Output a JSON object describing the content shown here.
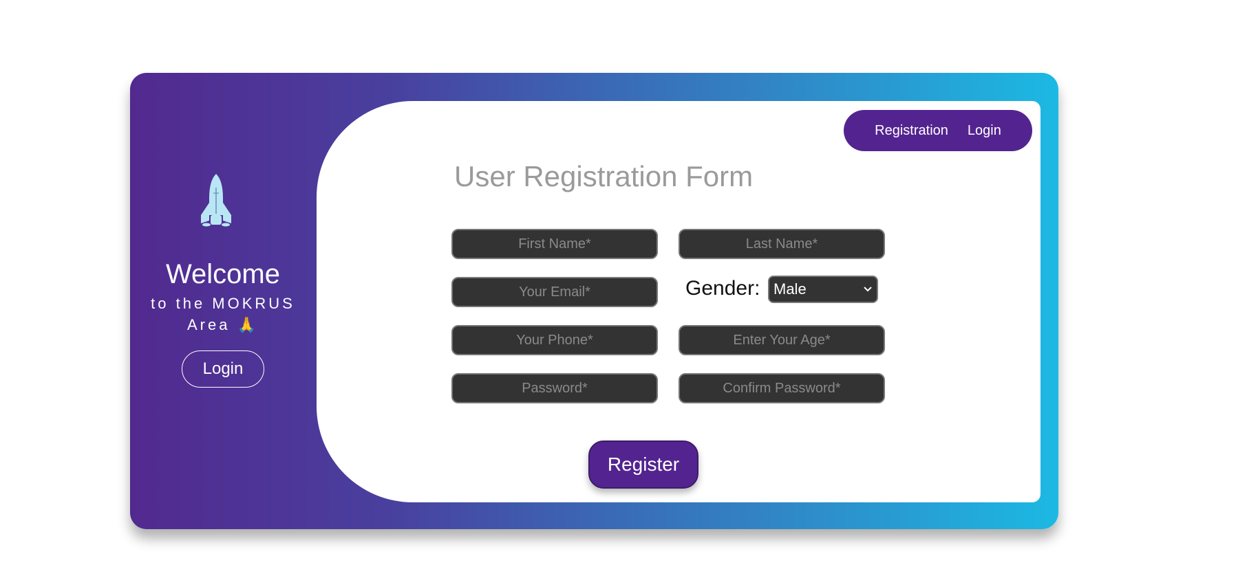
{
  "sidebar": {
    "rocket_icon": "rocket-icon",
    "welcome": "Welcome",
    "subtitle_line1": "to the MOKRUS",
    "subtitle_line2": "Area 🙏",
    "login_button": "Login"
  },
  "nav": {
    "registration": "Registration",
    "login": "Login"
  },
  "form": {
    "title": "User Registration Form",
    "first_name_placeholder": "First Name*",
    "last_name_placeholder": "Last Name*",
    "email_placeholder": "Your Email*",
    "gender_label": "Gender:",
    "gender_value": "Male",
    "phone_placeholder": "Your Phone*",
    "age_placeholder": "Enter Your Age*",
    "password_placeholder": "Password*",
    "confirm_password_placeholder": "Confirm Password*",
    "register_button": "Register"
  },
  "colors": {
    "brand_purple": "#53248f",
    "gradient_start": "#52298f",
    "gradient_end": "#1cb9e3",
    "field_bg": "#333333"
  }
}
